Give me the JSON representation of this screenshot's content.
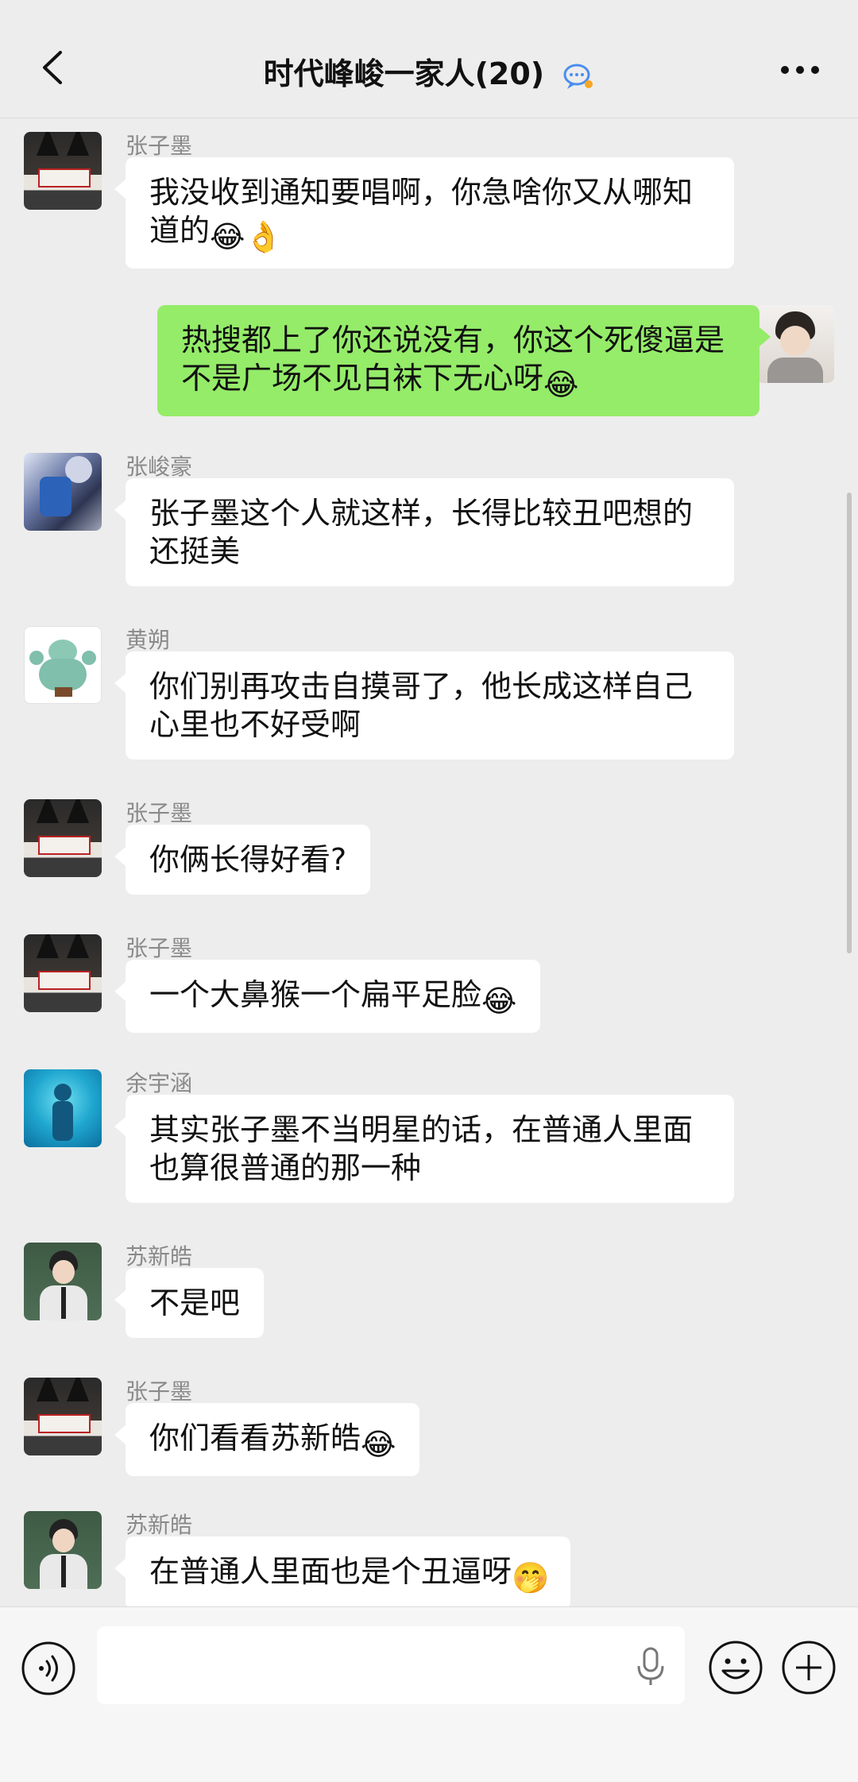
{
  "header": {
    "title": "时代峰峻一家人(20)"
  },
  "messages": [
    {
      "sender": "张子墨",
      "text": "我没收到通知要唱啊，你急啥你又从哪知道的",
      "emojis": [
        "😂",
        "👌"
      ]
    },
    {
      "sender": "",
      "text": "热搜都上了你还说没有，你这个死傻逼是不是广场不见白袜下无心呀",
      "emojis": [
        "😂"
      ]
    },
    {
      "sender": "张峻豪",
      "text": "张子墨这个人就这样，长得比较丑吧想的还挺美",
      "emojis": []
    },
    {
      "sender": "黄朔",
      "text": "你们别再攻击自摸哥了，他长成这样自己心里也不好受啊",
      "emojis": []
    },
    {
      "sender": "张子墨",
      "text": "你俩长得好看?",
      "emojis": []
    },
    {
      "sender": "张子墨",
      "text": "一个大鼻猴一个扁平足脸",
      "emojis": [
        "😂"
      ]
    },
    {
      "sender": "余宇涵",
      "text": "其实张子墨不当明星的话，在普通人里面也算很普通的那一种",
      "emojis": []
    },
    {
      "sender": "苏新皓",
      "text": "不是吧",
      "emojis": []
    },
    {
      "sender": "张子墨",
      "text": "你们看看苏新皓",
      "emojis": [
        "😂"
      ]
    },
    {
      "sender": "苏新皓",
      "text": "在普通人里面也是个丑逼呀",
      "emojis": [
        "🤭"
      ]
    }
  ],
  "input": {
    "value": "",
    "placeholder": ""
  },
  "icons": {
    "back": "chevron-left-icon",
    "more": "more-dots-icon",
    "voice": "voice-icon",
    "mic": "mic-icon",
    "emoji": "emoji-icon",
    "plus": "plus-icon"
  },
  "colors": {
    "background": "#ededed",
    "self_bubble": "#95ec69",
    "other_bubble": "#ffffff",
    "name_text": "#8a8a8a"
  }
}
